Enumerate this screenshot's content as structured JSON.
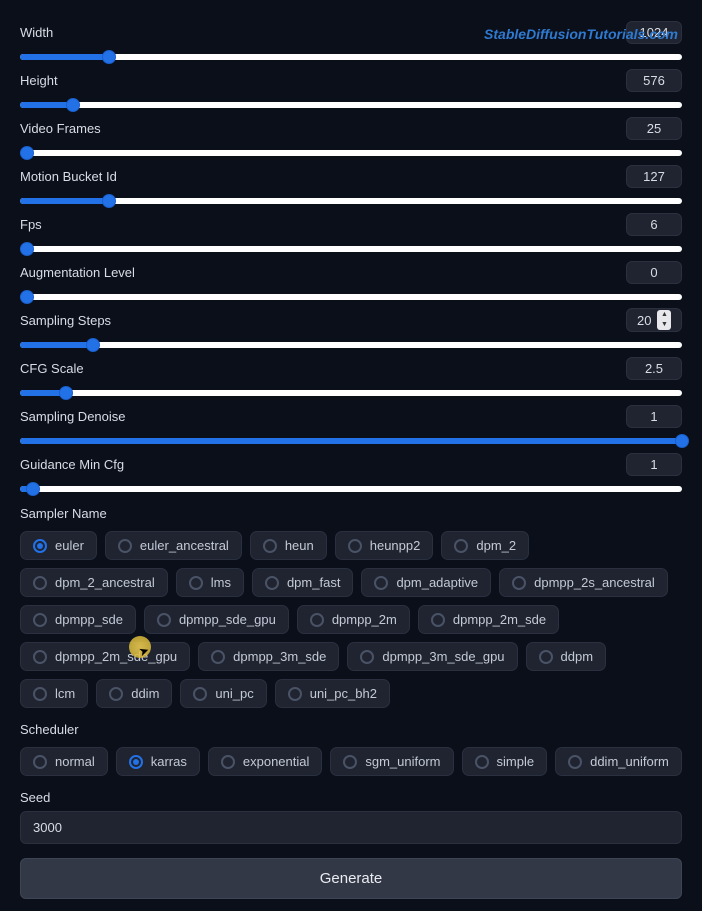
{
  "watermark": "StableDiffusionTutorials.com",
  "sliders": [
    {
      "key": "width",
      "label": "Width",
      "value": "1024",
      "fill": 13.5
    },
    {
      "key": "height",
      "label": "Height",
      "value": "576",
      "fill": 8
    },
    {
      "key": "video_frames",
      "label": "Video Frames",
      "value": "25",
      "fill": 1
    },
    {
      "key": "motion_bucket",
      "label": "Motion Bucket Id",
      "value": "127",
      "fill": 13.5
    },
    {
      "key": "fps",
      "label": "Fps",
      "value": "6",
      "fill": 1
    },
    {
      "key": "aug_level",
      "label": "Augmentation Level",
      "value": "0",
      "fill": 1
    },
    {
      "key": "sampling_steps",
      "label": "Sampling Steps",
      "value": "20",
      "fill": 11,
      "stepper": true
    },
    {
      "key": "cfg_scale",
      "label": "CFG Scale",
      "value": "2.5",
      "fill": 7
    },
    {
      "key": "sampling_denoise",
      "label": "Sampling Denoise",
      "value": "1",
      "fill": 100
    },
    {
      "key": "guidance_min_cfg",
      "label": "Guidance Min Cfg",
      "value": "1",
      "fill": 2
    }
  ],
  "sampler": {
    "label": "Sampler Name",
    "options": [
      "euler",
      "euler_ancestral",
      "heun",
      "heunpp2",
      "dpm_2",
      "dpm_2_ancestral",
      "lms",
      "dpm_fast",
      "dpm_adaptive",
      "dpmpp_2s_ancestral",
      "dpmpp_sde",
      "dpmpp_sde_gpu",
      "dpmpp_2m",
      "dpmpp_2m_sde",
      "dpmpp_2m_sde_gpu",
      "dpmpp_3m_sde",
      "dpmpp_3m_sde_gpu",
      "ddpm",
      "lcm",
      "ddim",
      "uni_pc",
      "uni_pc_bh2"
    ],
    "selected": "euler"
  },
  "scheduler": {
    "label": "Scheduler",
    "options": [
      "normal",
      "karras",
      "exponential",
      "sgm_uniform",
      "simple",
      "ddim_uniform"
    ],
    "selected": "karras"
  },
  "seed": {
    "label": "Seed",
    "value": "3000"
  },
  "generate_label": "Generate"
}
